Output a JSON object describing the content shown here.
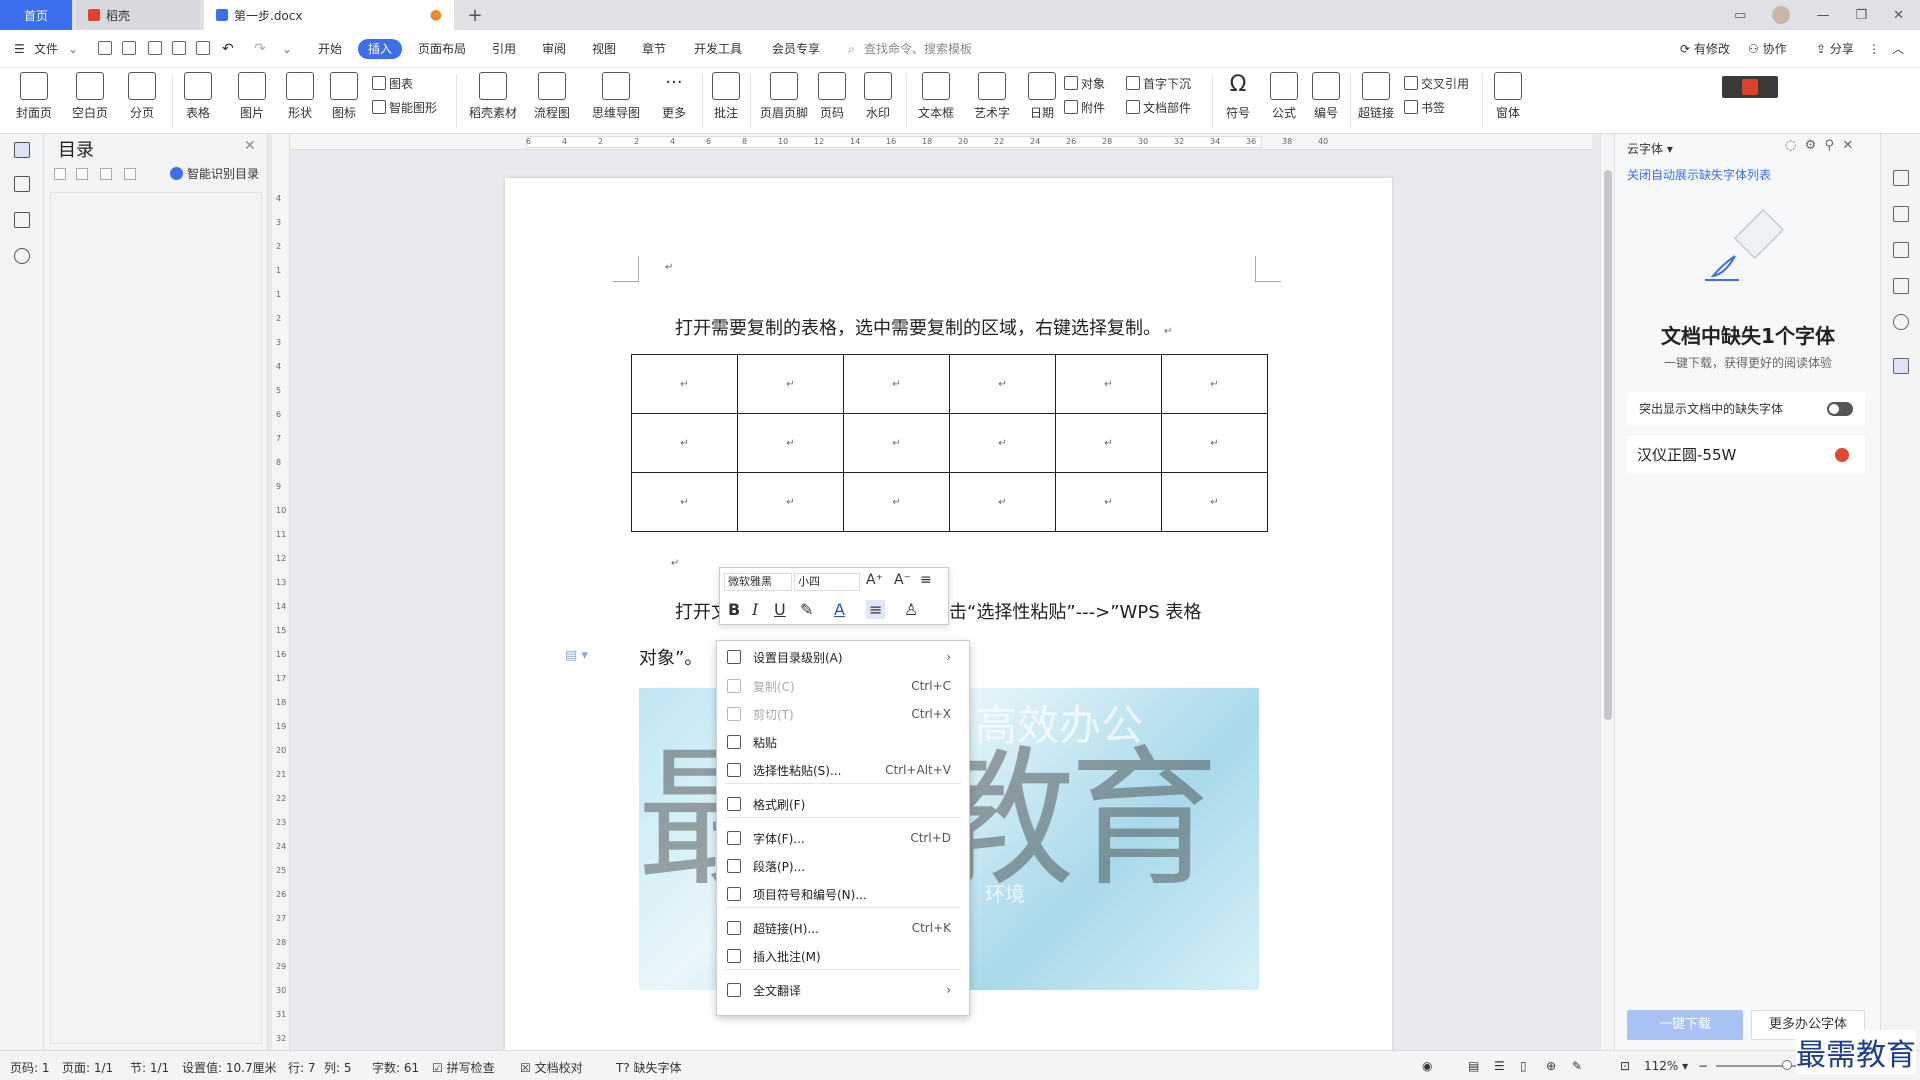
{
  "tabs": {
    "home": "首页",
    "daoke": "稻壳",
    "doc": "第一步.docx"
  },
  "menu": {
    "file": "文件",
    "items": [
      "开始",
      "插入",
      "页面布局",
      "引用",
      "审阅",
      "视图",
      "章节",
      "开发工具",
      "会员专享"
    ],
    "search_placeholder": "查找命令、搜索模板",
    "modified": "有修改",
    "collab": "协作",
    "share": "分享"
  },
  "ribbon": {
    "cover": "封面页",
    "blank": "空白页",
    "pagebreak": "分页",
    "table": "表格",
    "picture": "图片",
    "shape": "形状",
    "icon": "图标",
    "chart": "图表",
    "smartart": "智能图形",
    "material": "稻壳素材",
    "flow": "流程图",
    "mindmap": "思维导图",
    "more": "更多",
    "comment": "批注",
    "headerfooter": "页眉页脚",
    "pagenum": "页码",
    "watermark": "水印",
    "textbox": "文本框",
    "wordart": "艺术字",
    "date": "日期",
    "object": "对象",
    "dropcap": "首字下沉",
    "attach": "附件",
    "docpart": "文档部件",
    "symbol": "符号",
    "formula": "公式",
    "numbering": "编号",
    "hyperlink": "超链接",
    "crossref": "交叉引用",
    "bookmark": "书签",
    "window": "窗体"
  },
  "nav": {
    "title": "目录",
    "smart": "智能识别目录"
  },
  "ruler_top": [
    "6",
    "4",
    "2",
    "2",
    "4",
    "6",
    "8",
    "10",
    "12",
    "14",
    "16",
    "18",
    "20",
    "22",
    "24",
    "26",
    "28",
    "30",
    "32",
    "34",
    "36",
    "38",
    "40"
  ],
  "ruler_left": [
    "4",
    "3",
    "2",
    "1",
    "1",
    "2",
    "3",
    "4",
    "5",
    "6",
    "7",
    "8",
    "9",
    "10",
    "11",
    "12",
    "13",
    "14",
    "15",
    "16",
    "17",
    "18",
    "19",
    "20",
    "21",
    "22",
    "23",
    "24",
    "25",
    "26",
    "27",
    "28",
    "29",
    "30",
    "31",
    "32"
  ],
  "doc": {
    "para1": "打开需要复制的表格，选中需要复制的区域，右键选择复制。",
    "para2a": "打开文",
    "para2b": "键点击“选择性粘贴”--->”WPS 表格",
    "para3": "对象”。",
    "return_mark": "↵",
    "table_rows": 3,
    "table_cols": 6,
    "watermark": "最需教育",
    "img_text1": "高效办公",
    "img_text2": "环境"
  },
  "minitb": {
    "font": "微软雅黑",
    "size": "小四",
    "bold": "B",
    "italic": "I",
    "underline": "U"
  },
  "context_menu": [
    {
      "label": "设置目录级别(A)",
      "shortcut": "",
      "arrow": "›",
      "disabled": false,
      "icon": "toc-level-icon"
    },
    {
      "label": "复制(C)",
      "shortcut": "Ctrl+C",
      "disabled": true,
      "icon": "copy-icon"
    },
    {
      "label": "剪切(T)",
      "shortcut": "Ctrl+X",
      "disabled": true,
      "icon": "cut-icon"
    },
    {
      "label": "粘贴",
      "shortcut": "",
      "disabled": false,
      "icon": "paste-icon"
    },
    {
      "label": "选择性粘贴(S)...",
      "shortcut": "Ctrl+Alt+V",
      "disabled": false,
      "icon": "paste-special-icon"
    },
    {
      "label": "格式刷(F)",
      "shortcut": "",
      "disabled": false,
      "icon": "format-painter-icon"
    },
    {
      "label": "字体(F)...",
      "shortcut": "Ctrl+D",
      "disabled": false,
      "icon": "font-icon"
    },
    {
      "label": "段落(P)...",
      "shortcut": "",
      "disabled": false,
      "icon": "paragraph-icon"
    },
    {
      "label": "项目符号和编号(N)...",
      "shortcut": "",
      "disabled": false,
      "icon": "bullets-icon"
    },
    {
      "label": "超链接(H)...",
      "shortcut": "Ctrl+K",
      "disabled": false,
      "icon": "hyperlink-icon"
    },
    {
      "label": "插入批注(M)",
      "shortcut": "",
      "disabled": false,
      "icon": "comment-icon"
    },
    {
      "label": "全文翻译",
      "shortcut": "",
      "arrow": "›",
      "disabled": false,
      "icon": "translate-icon"
    }
  ],
  "right_panel": {
    "header": "云字体",
    "link": "关闭自动展示缺失字体列表",
    "title": "文档中缺失1个字体",
    "subtitle": "一键下载，获得更好的阅读体验",
    "toggle_label": "突出显示文档中的缺失字体",
    "font_name": "汉仪正圆-55W",
    "download": "一键下载",
    "more": "更多办公字体"
  },
  "status": {
    "page": "页码: 1",
    "pages": "页面: 1/1",
    "section": "节: 1/1",
    "setting": "设置值: 10.7厘米",
    "row": "行: 7",
    "col": "列: 5",
    "words": "字数: 61",
    "spell": "拼写检查",
    "proof": "文档校对",
    "missing": "缺失字体",
    "zoom": "112%"
  },
  "logo_text": "最需教育",
  "colors": {
    "accent": "#3c6ef0",
    "ribbon_bg": "#ffffff",
    "page_bg": "#e8eaed"
  }
}
